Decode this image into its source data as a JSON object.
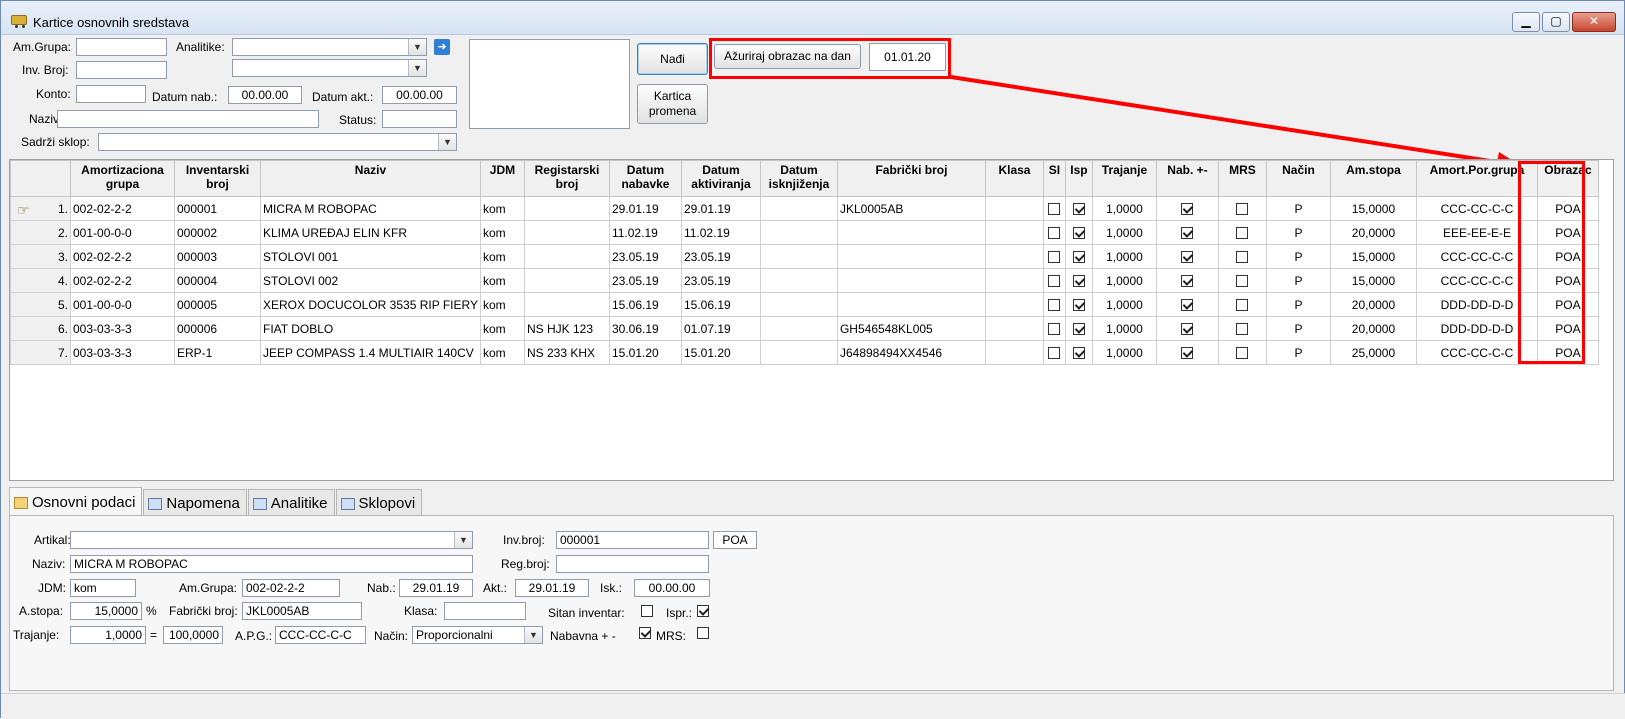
{
  "window": {
    "title": "Kartice osnovnih sredstava",
    "buttons": {
      "minimize": "▁",
      "maximize": "▢",
      "close": "✕"
    }
  },
  "filters": {
    "am_grupa_label": "Am.Grupa:",
    "am_grupa_value": "",
    "analitike_label": "Analitike:",
    "analitike_value": "",
    "analitike2_value": "",
    "inv_broj_label": "Inv. Broj:",
    "inv_broj_value": "",
    "konto_label": "Konto:",
    "konto_value": "",
    "datum_nab_label": "Datum nab.:",
    "datum_nab_value": "00.00.00",
    "datum_akt_label": "Datum akt.:",
    "datum_akt_value": "00.00.00",
    "naziv_label": "Naziv:",
    "naziv_value": "",
    "status_label": "Status:",
    "status_value": "",
    "sadrzi_sklop_label": "Sadrži sklop:",
    "sadrzi_sklop_value": "",
    "nadji_button": "Nađi",
    "kartica_promena_button": [
      "Kartica",
      "promena"
    ],
    "azuriraj_button": "Ažuriraj obrazac na dan",
    "azuriraj_date": "01.01.20"
  },
  "grid": {
    "columns": [
      [
        "Amortizaciona",
        "grupa"
      ],
      [
        "Inventarski",
        "broj"
      ],
      [
        "Naziv",
        ""
      ],
      [
        "JDM",
        ""
      ],
      [
        "Registarski",
        "broj"
      ],
      [
        "Datum",
        "nabavke"
      ],
      [
        "Datum",
        "aktiviranja"
      ],
      [
        "Datum",
        "isknjiženja"
      ],
      [
        "Fabrički broj",
        ""
      ],
      [
        "Klasa",
        ""
      ],
      [
        "SI",
        ""
      ],
      [
        "Isp",
        ""
      ],
      [
        "Trajanje",
        ""
      ],
      [
        "Nab. +-",
        ""
      ],
      [
        "MRS",
        ""
      ],
      [
        "Način",
        ""
      ],
      [
        "Am.stopa",
        ""
      ],
      [
        "Amort.Por.grupa",
        ""
      ],
      [
        "Obrazac",
        ""
      ]
    ],
    "rows": [
      {
        "n": "1.",
        "grupa": "002-02-2-2",
        "inv": "000001",
        "naziv": "MICRA M ROBOPAC",
        "jdm": "kom",
        "reg": "",
        "nab": "29.01.19",
        "akt": "29.01.19",
        "isk": "",
        "fab": "JKL0005AB",
        "klasa": "",
        "si": false,
        "isp": true,
        "traj": "1,0000",
        "nabpm": true,
        "mrs": false,
        "nacin": "P",
        "stopa": "15,0000",
        "apg": "CCC-CC-C-C",
        "obr": "POA"
      },
      {
        "n": "2.",
        "grupa": "001-00-0-0",
        "inv": "000002",
        "naziv": "KLIMA UREĐAJ ELIN KFR",
        "jdm": "kom",
        "reg": "",
        "nab": "11.02.19",
        "akt": "11.02.19",
        "isk": "",
        "fab": "",
        "klasa": "",
        "si": false,
        "isp": true,
        "traj": "1,0000",
        "nabpm": true,
        "mrs": false,
        "nacin": "P",
        "stopa": "20,0000",
        "apg": "EEE-EE-E-E",
        "obr": "POA"
      },
      {
        "n": "3.",
        "grupa": "002-02-2-2",
        "inv": "000003",
        "naziv": "STOLOVI 001",
        "jdm": "kom",
        "reg": "",
        "nab": "23.05.19",
        "akt": "23.05.19",
        "isk": "",
        "fab": "",
        "klasa": "",
        "si": false,
        "isp": true,
        "traj": "1,0000",
        "nabpm": true,
        "mrs": false,
        "nacin": "P",
        "stopa": "15,0000",
        "apg": "CCC-CC-C-C",
        "obr": "POA"
      },
      {
        "n": "4.",
        "grupa": "002-02-2-2",
        "inv": "000004",
        "naziv": "STOLOVI 002",
        "jdm": "kom",
        "reg": "",
        "nab": "23.05.19",
        "akt": "23.05.19",
        "isk": "",
        "fab": "",
        "klasa": "",
        "si": false,
        "isp": true,
        "traj": "1,0000",
        "nabpm": true,
        "mrs": false,
        "nacin": "P",
        "stopa": "15,0000",
        "apg": "CCC-CC-C-C",
        "obr": "POA"
      },
      {
        "n": "5.",
        "grupa": "001-00-0-0",
        "inv": "000005",
        "naziv": "XEROX DOCUCOLOR 3535 RIP FIERY",
        "jdm": "kom",
        "reg": "",
        "nab": "15.06.19",
        "akt": "15.06.19",
        "isk": "",
        "fab": "",
        "klasa": "",
        "si": false,
        "isp": true,
        "traj": "1,0000",
        "nabpm": true,
        "mrs": false,
        "nacin": "P",
        "stopa": "20,0000",
        "apg": "DDD-DD-D-D",
        "obr": "POA"
      },
      {
        "n": "6.",
        "grupa": "003-03-3-3",
        "inv": "000006",
        "naziv": "FIAT DOBLO",
        "jdm": "kom",
        "reg": "NS HJK 123",
        "nab": "30.06.19",
        "akt": "01.07.19",
        "isk": "",
        "fab": "GH546548KL005",
        "klasa": "",
        "si": false,
        "isp": true,
        "traj": "1,0000",
        "nabpm": true,
        "mrs": false,
        "nacin": "P",
        "stopa": "20,0000",
        "apg": "DDD-DD-D-D",
        "obr": "POA"
      },
      {
        "n": "7.",
        "grupa": "003-03-3-3",
        "inv": "ERP-1",
        "naziv": "JEEP COMPASS 1.4 MULTIAIR 140CV",
        "jdm": "kom",
        "reg": "NS 233 KHX",
        "nab": "15.01.20",
        "akt": "15.01.20",
        "isk": "",
        "fab": "J64898494XX4546",
        "klasa": "",
        "si": false,
        "isp": true,
        "traj": "1,0000",
        "nabpm": true,
        "mrs": false,
        "nacin": "P",
        "stopa": "25,0000",
        "apg": "CCC-CC-C-C",
        "obr": "POA"
      }
    ]
  },
  "tabs": [
    "Osnovni podaci",
    "Napomena",
    "Analitike",
    "Sklopovi"
  ],
  "details": {
    "artikal_label": "Artikal:",
    "artikal_value": "",
    "inv_broj_label": "Inv.broj:",
    "inv_broj_value": "000001",
    "obrazac_value": "POA",
    "naziv_label": "Naziv:",
    "naziv_value": "MICRA M ROBOPAC",
    "reg_broj_label": "Reg.broj:",
    "reg_broj_value": "",
    "jdm_label": "JDM:",
    "jdm_value": "kom",
    "am_grupa_label": "Am.Grupa:",
    "am_grupa_value": "002-02-2-2",
    "nab_label": "Nab.:",
    "nab_value": "29.01.19",
    "akt_label": "Akt.:",
    "akt_value": "29.01.19",
    "isk_label": "Isk.:",
    "isk_value": "00.00.00",
    "a_stopa_label": "A.stopa:",
    "a_stopa_value": "15,0000",
    "percent": "%",
    "fab_broj_label": "Fabrički broj:",
    "fab_broj_value": "JKL0005AB",
    "klasa_label": "Klasa:",
    "klasa_value": "",
    "sitan_inventar_label": "Sitan inventar:",
    "ispr_label": "Ispr.:",
    "trajanje_label": "Trajanje:",
    "trajanje_value": "1,0000",
    "equals": "=",
    "trajanje2_value": "100,0000",
    "apg_label": "A.P.G.:",
    "apg_value": "CCC-CC-C-C",
    "nacin_label": "Način:",
    "nacin_value": "Proporcionalni",
    "nabavna_label": "Nabavna + -",
    "mrs_label": "MRS:"
  },
  "colors": {
    "highlight": "#ff0000",
    "arrow_button": "#2f7fd6"
  }
}
